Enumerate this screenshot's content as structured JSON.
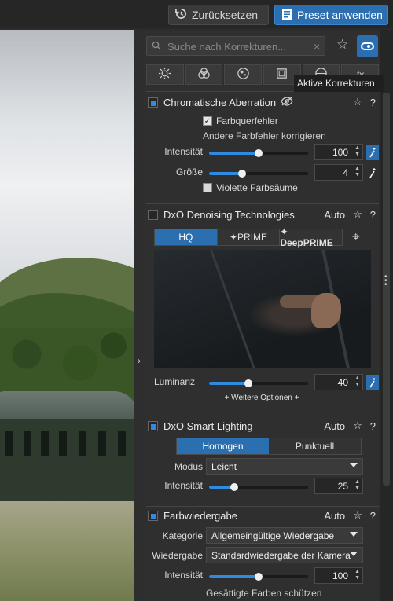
{
  "toolbar": {
    "reset_label": "Zurücksetzen",
    "preset_label": "Preset anwenden"
  },
  "panel": {
    "search_placeholder": "Suche nach Korrekturen...",
    "tooltip": "Aktive Korrekturen",
    "tabs": [
      "sun-icon",
      "color-circles-icon",
      "detail-icon",
      "geometry-icon",
      "local-icon",
      "fx-icon"
    ]
  },
  "sections": {
    "chromatic": {
      "title": "Chromatische Aberration",
      "lateral_label": "Farbquerfehler",
      "lateral_checked": true,
      "other_label": "Andere Farbfehler korrigieren",
      "intensity_label": "Intensität",
      "intensity_value": "100",
      "intensity_fraction": 0.5,
      "size_label": "Größe",
      "size_value": "4",
      "size_fraction": 0.33,
      "purple_label": "Violette Farbsäume",
      "purple_checked": false
    },
    "denoise": {
      "title": "DxO Denoising Technologies",
      "auto": "Auto",
      "modes": [
        "HQ",
        "✦PRIME",
        "✦ DeepPRIME"
      ],
      "selected_mode": "HQ",
      "luminance_label": "Luminanz",
      "luminance_value": "40",
      "luminance_fraction": 0.4,
      "more_options": "+ Weitere Optionen +"
    },
    "smart_lighting": {
      "title": "DxO Smart Lighting",
      "auto": "Auto",
      "modes": [
        "Homogen",
        "Punktuell"
      ],
      "selected_mode": "Homogen",
      "mode_label": "Modus",
      "mode_value": "Leicht",
      "intensity_label": "Intensität",
      "intensity_value": "25",
      "intensity_fraction": 0.25
    },
    "color_rendering": {
      "title": "Farbwiedergabe",
      "auto": "Auto",
      "category_label": "Kategorie",
      "category_value": "Allgemeingültige Wiedergabe",
      "rendering_label": "Wiedergabe",
      "rendering_value": "Standardwiedergabe der Kamera",
      "intensity_label": "Intensität",
      "intensity_value": "100",
      "intensity_fraction": 0.5,
      "protect_label": "Gesättigte Farben schützen"
    }
  },
  "colors": {
    "accent": "#2c6fb0",
    "checkbox_on": "#2f8ae0",
    "panel_bg": "#2f2f2f"
  }
}
